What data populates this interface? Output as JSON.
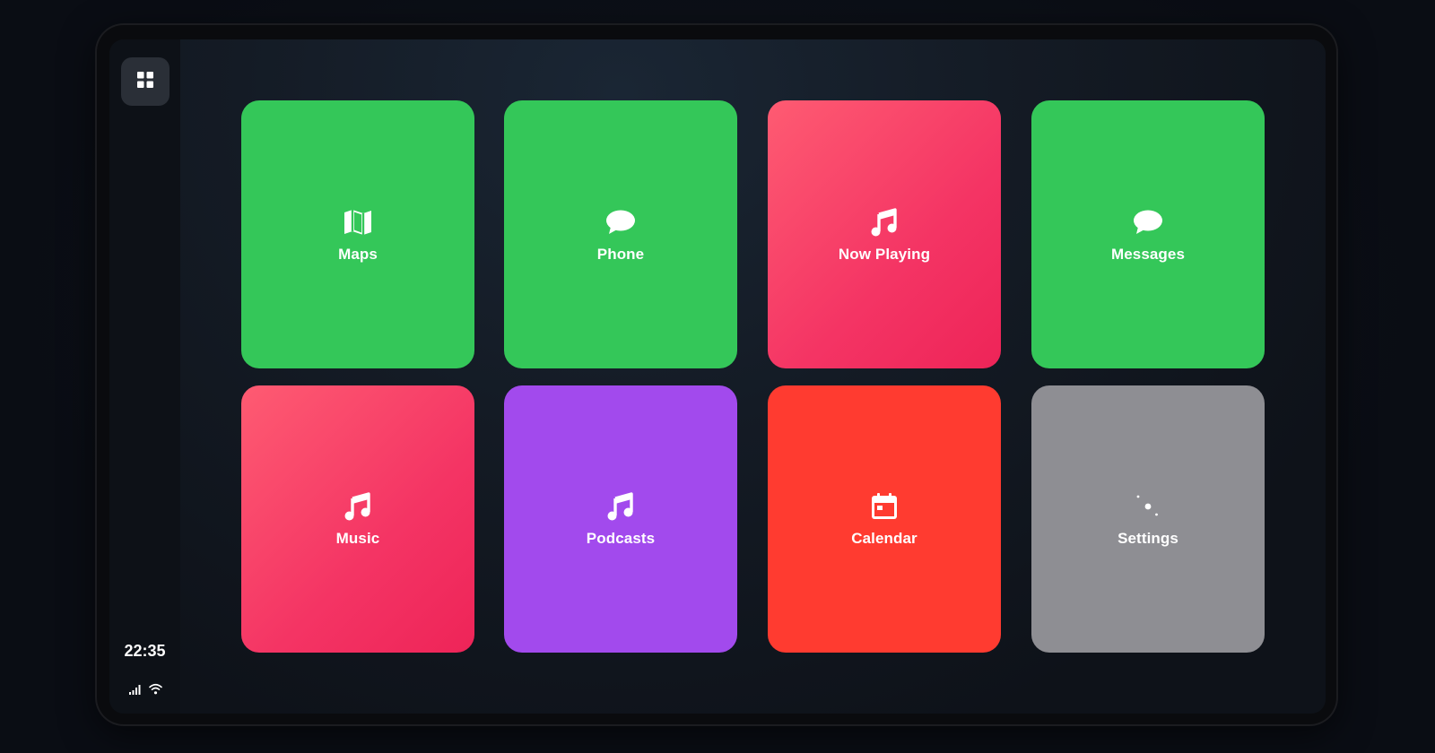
{
  "status": {
    "time": "22:35",
    "icons": [
      "cellular-signal-icon",
      "wifi-icon"
    ]
  },
  "home": {
    "icon": "app-grid-icon"
  },
  "apps": [
    {
      "label": "Maps",
      "icon": "map-icon",
      "color": "#34c759"
    },
    {
      "label": "Phone",
      "icon": "chat-bubble-icon",
      "color": "#34c759"
    },
    {
      "label": "Now Playing",
      "icon": "music-note-icon",
      "color": "#fa2d55"
    },
    {
      "label": "Messages",
      "icon": "chat-bubble-icon",
      "color": "#34c759"
    },
    {
      "label": "Music",
      "icon": "music-note-icon",
      "color": "#fa2d55"
    },
    {
      "label": "Podcasts",
      "icon": "music-note-icon",
      "color": "#a24aed"
    },
    {
      "label": "Calendar",
      "icon": "calendar-icon",
      "color": "#ff3b30"
    },
    {
      "label": "Settings",
      "icon": "gear-icon",
      "color": "#8e8e93"
    }
  ]
}
